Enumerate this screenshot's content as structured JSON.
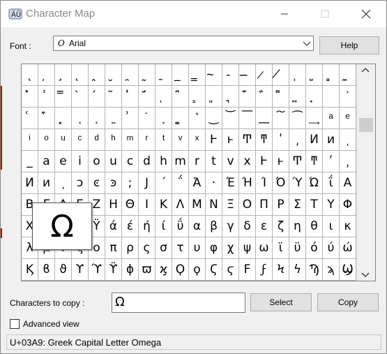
{
  "window": {
    "title": "Character Map",
    "minimize_icon": "minimize-icon",
    "maximize_icon": "maximize-icon",
    "close_icon": "close-icon"
  },
  "font": {
    "label": "Font :",
    "value": "Arial",
    "help_label": "Help"
  },
  "grid": {
    "rows": [
      [
        "˛",
        "̦",
        "̧",
        "̨",
        "̭",
        "̮",
        "̯",
        "̰",
        "̱",
        "̲",
        "̳",
        "̴",
        "̵",
        "̶",
        "̷",
        "̸",
        "̹",
        "̺",
        "̻",
        "̼"
      ],
      [
        "̽",
        "̾",
        "̿",
        "̀",
        "́",
        "͂",
        "̓",
        "̈́",
        "ͅ",
        "͆",
        "͇",
        "͈",
        "͉",
        "͊",
        "͋",
        "͌",
        "͍",
        "͎",
        "͏",
        "͐"
      ],
      [
        "͑",
        "͒",
        "͓",
        "͔",
        "͕",
        "͖",
        "͗",
        "͘",
        "͙",
        "͚",
        "͛",
        "͜",
        "͝",
        "͞",
        "͟",
        "͠",
        "͡",
        "͢",
        "ͣ",
        "ͤ"
      ],
      [
        "ͥ",
        "ͦ",
        "ͧ",
        "ͨ",
        "ͩ",
        "ͪ",
        "ͫ",
        "ͬ",
        "ͭ",
        "ͮ",
        "ͯ",
        "Ͱ",
        "ͱ",
        "Ͳ",
        "ͳ",
        "ʹ",
        "͵",
        "Ͷ",
        "ͷ",
        "ͺ"
      ],
      [
        "_",
        "a",
        "e",
        "i",
        "o",
        "u",
        "c",
        "d",
        "h",
        "m",
        "r",
        "t",
        "v",
        "x",
        "Ͱ",
        "ͱ",
        "Ͳ",
        "ͳ",
        "ʹ",
        "͵"
      ],
      [
        "Ͷ",
        "ͷ",
        "ͺ",
        "ͻ",
        "ͼ",
        "ͽ",
        ";",
        "Ϳ",
        "΄",
        "΅",
        "Ά",
        "·",
        "Έ",
        "Ή",
        "Ί",
        "Ό",
        "Ύ",
        "Ώ",
        "ΐ",
        "Α"
      ],
      [
        "Β",
        "Γ",
        "Δ",
        "Ε",
        "Ζ",
        "Η",
        "Θ",
        "Ι",
        "Κ",
        "Λ",
        "Μ",
        "Ν",
        "Ξ",
        "Ο",
        "Π",
        "Ρ",
        "Σ",
        "Τ",
        "Υ",
        "Φ"
      ],
      [
        "Χ",
        "Ψ",
        "Ω",
        "Ϊ",
        "Ϋ",
        "ά",
        "έ",
        "ή",
        "ί",
        "ΰ",
        "α",
        "β",
        "γ",
        "δ",
        "ε",
        "ζ",
        "η",
        "θ",
        "ι",
        "κ"
      ],
      [
        "λ",
        "μ",
        "ν",
        "ξ",
        "ο",
        "π",
        "ρ",
        "ς",
        "σ",
        "τ",
        "υ",
        "φ",
        "χ",
        "ψ",
        "ω",
        "ϊ",
        "ϋ",
        "ό",
        "ύ",
        "ώ"
      ],
      [
        "Ϗ",
        "ϐ",
        "ϑ",
        "ϒ",
        "ϓ",
        "ϔ",
        "ϕ",
        "ϖ",
        "ϗ",
        "Ϙ",
        "ϙ",
        "Ϛ",
        "ϛ",
        "Ϝ",
        "ϝ",
        "Ϟ",
        "ϟ",
        "Ϡ",
        "ϡ",
        "Ϣ"
      ]
    ],
    "enlarged_char": "Ω"
  },
  "copy": {
    "label": "Characters to copy :",
    "value": "Ω",
    "select_label": "Select",
    "copy_label": "Copy"
  },
  "advanced": {
    "label": "Advanced view",
    "checked": false
  },
  "status": {
    "text": "U+03A9: Greek Capital Letter Omega"
  }
}
